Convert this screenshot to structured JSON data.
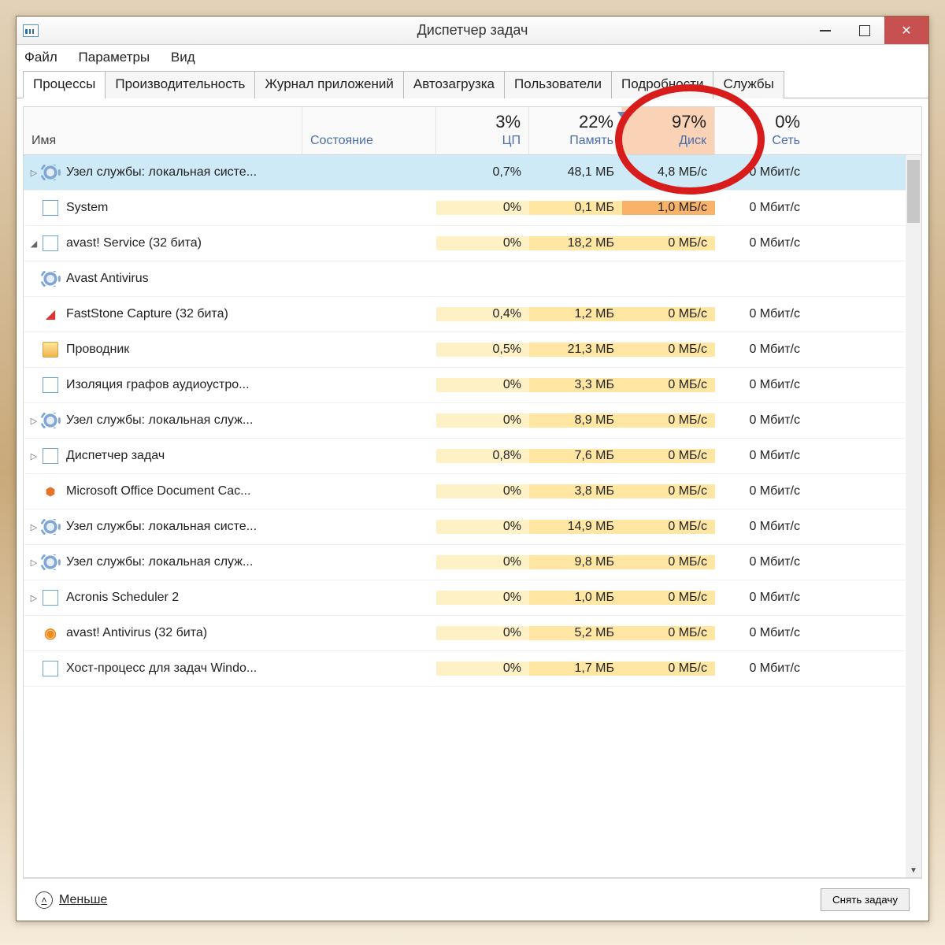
{
  "window": {
    "title": "Диспетчер задач"
  },
  "menu": {
    "file": "Файл",
    "options": "Параметры",
    "view": "Вид"
  },
  "tabs": [
    "Процессы",
    "Производительность",
    "Журнал приложений",
    "Автозагрузка",
    "Пользователи",
    "Подробности",
    "Службы"
  ],
  "headers": {
    "name": "Имя",
    "state": "Состояние",
    "cpu_pct": "3%",
    "cpu_lbl": "ЦП",
    "mem_pct": "22%",
    "mem_lbl": "Память",
    "disk_pct": "97%",
    "disk_lbl": "Диск",
    "net_pct": "0%",
    "net_lbl": "Сеть"
  },
  "rows": [
    {
      "exp": "▷",
      "icon": "gear",
      "name": "Узел службы: локальная систе...",
      "cpu": "0,7%",
      "mem": "48,1 МБ",
      "disk": "4,8 МБ/с",
      "net": "0 Мбит/с",
      "selected": true
    },
    {
      "exp": "",
      "icon": "app",
      "name": "System",
      "cpu": "0%",
      "mem": "0,1 МБ",
      "disk": "1,0 МБ/с",
      "net": "0 Мбит/с",
      "rowclass": "r1"
    },
    {
      "exp": "◢",
      "icon": "app",
      "name": "avast! Service (32 бита)",
      "cpu": "0%",
      "mem": "18,2 МБ",
      "disk": "0 МБ/с",
      "net": "0 Мбит/с"
    },
    {
      "exp": "",
      "icon": "gear",
      "name": "Avast Antivirus",
      "cpu": "",
      "mem": "",
      "disk": "",
      "net": "",
      "child": true
    },
    {
      "exp": "",
      "icon": "fast",
      "name": "FastStone Capture (32 бита)",
      "cpu": "0,4%",
      "mem": "1,2 МБ",
      "disk": "0 МБ/с",
      "net": "0 Мбит/с"
    },
    {
      "exp": "",
      "icon": "folder",
      "name": "Проводник",
      "cpu": "0,5%",
      "mem": "21,3 МБ",
      "disk": "0 МБ/с",
      "net": "0 Мбит/с"
    },
    {
      "exp": "",
      "icon": "app",
      "name": "Изоляция графов аудиоустро...",
      "cpu": "0%",
      "mem": "3,3 МБ",
      "disk": "0 МБ/с",
      "net": "0 Мбит/с"
    },
    {
      "exp": "▷",
      "icon": "gear",
      "name": "Узел службы: локальная служ...",
      "cpu": "0%",
      "mem": "8,9 МБ",
      "disk": "0 МБ/с",
      "net": "0 Мбит/с"
    },
    {
      "exp": "▷",
      "icon": "tm",
      "name": "Диспетчер задач",
      "cpu": "0,8%",
      "mem": "7,6 МБ",
      "disk": "0 МБ/с",
      "net": "0 Мбит/с"
    },
    {
      "exp": "",
      "icon": "office",
      "name": "Microsoft Office Document Cac...",
      "cpu": "0%",
      "mem": "3,8 МБ",
      "disk": "0 МБ/с",
      "net": "0 Мбит/с"
    },
    {
      "exp": "▷",
      "icon": "gear",
      "name": "Узел службы: локальная систе...",
      "cpu": "0%",
      "mem": "14,9 МБ",
      "disk": "0 МБ/с",
      "net": "0 Мбит/с"
    },
    {
      "exp": "▷",
      "icon": "gear",
      "name": "Узел службы: локальная служ...",
      "cpu": "0%",
      "mem": "9,8 МБ",
      "disk": "0 МБ/с",
      "net": "0 Мбит/с"
    },
    {
      "exp": "▷",
      "icon": "app",
      "name": "Acronis Scheduler 2",
      "cpu": "0%",
      "mem": "1,0 МБ",
      "disk": "0 МБ/с",
      "net": "0 Мбит/с"
    },
    {
      "exp": "",
      "icon": "avast",
      "name": "avast! Antivirus (32 бита)",
      "cpu": "0%",
      "mem": "5,2 МБ",
      "disk": "0 МБ/с",
      "net": "0 Мбит/с"
    },
    {
      "exp": "",
      "icon": "app",
      "name": "Хост-процесс для задач Windo...",
      "cpu": "0%",
      "mem": "1,7 МБ",
      "disk": "0 МБ/с",
      "net": "0 Мбит/с"
    }
  ],
  "footer": {
    "fewer": "Меньше",
    "end_task": "Снять задачу"
  }
}
